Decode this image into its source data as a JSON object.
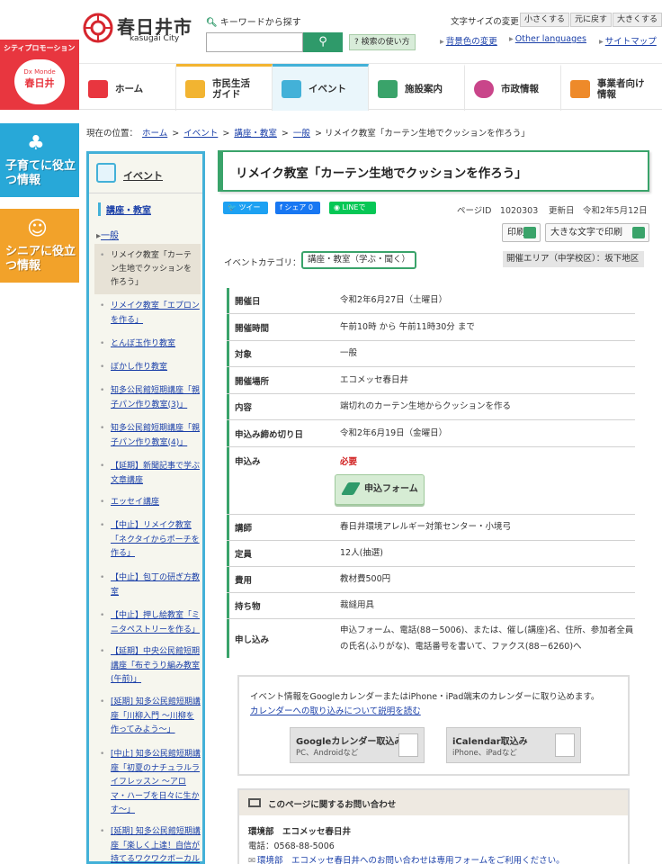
{
  "header": {
    "logo_jp": "春日井市",
    "logo_en": "kasugai City",
    "search_label": "キーワードから探す",
    "search_placeholder": "",
    "search_help": "検索の使い方",
    "font_size_label": "文字サイズの変更",
    "font_small": "小さくする",
    "font_reset": "元に戻す",
    "font_large": "大きくする",
    "bg_color": "背景色の変更",
    "other_lang": "Other languages",
    "sitemap": "サイトマップ"
  },
  "promos": {
    "city_promo_top": "シティプロモーション",
    "city_promo_brand": "Dx Monde",
    "city_promo_name": "春日井",
    "childcare": "子育てに役立つ情報",
    "senior": "シニアに役立つ情報"
  },
  "nav": {
    "items": [
      {
        "label": "ホーム"
      },
      {
        "label": "市民生活ガイド"
      },
      {
        "label": "イベント"
      },
      {
        "label": "施設案内"
      },
      {
        "label": "市政情報"
      },
      {
        "label": "事業者向け情報"
      }
    ]
  },
  "breadcrumb": {
    "prefix": "現在の位置：",
    "links": [
      "ホーム",
      "イベント",
      "講座・教室",
      "一般"
    ],
    "sep": ">",
    "current": "リメイク教室「カーテン生地でクッションを作ろう」"
  },
  "sidebar": {
    "heading": "イベント",
    "category": "講座・教室",
    "subcategory": "一般",
    "current": "リメイク教室「カーテン生地でクッションを作ろう」",
    "items": [
      "リメイク教室「エプロンを作る」",
      "とんぼ玉作り教室",
      "ぼかし作り教室",
      "知多公民館短期講座「親子パン作り教室(3)」",
      "知多公民館短期講座「親子パン作り教室(4)」",
      "【延期】新聞記事で学ぶ文章講座",
      "エッセイ講座",
      "【中止】リメイク教室「ネクタイからポーチを作る」",
      "【中止】包丁の研ぎ方教室",
      "【中止】押し絵教室「ミニタペストリーを作る」",
      "【延期】中央公民館短期講座「布ぞうり編み教室(午前)」",
      "[延期] 知多公民館短期講座「川柳入門 ～川柳を作ってみよう～」",
      "[中止] 知多公民館短期講座「初夏のナチュラルライフレッスン ～アロマ・ハーブを日々に生かす～」",
      "[延期] 知多公民館短期講座「楽しく上達！自信が持てるワクワクボーカル"
    ]
  },
  "page": {
    "title": "リメイク教室「カーテン生地でクッションを作ろう」",
    "tweet": "ツイート",
    "share": "シェア 0",
    "line": "LINEで送る",
    "page_id": "ページID　1020303",
    "updated": "更新日　令和2年5月12日",
    "print": "印刷",
    "print_large": "大きな文字で印刷",
    "category_label": "イベントカテゴリ：",
    "category_value": "講座・教室（学ぶ・聞く）",
    "area": "開催エリア（中学校区）：坂下地区"
  },
  "details": [
    {
      "key": "開催日",
      "value": "令和2年6月27日（土曜日）"
    },
    {
      "key": "開催時間",
      "value": "午前10時 から 午前11時30分 まで"
    },
    {
      "key": "対象",
      "value": "一般"
    },
    {
      "key": "開催場所",
      "value": "エコメッセ春日井"
    },
    {
      "key": "内容",
      "value": "端切れのカーテン生地からクッションを作る"
    },
    {
      "key": "申込み締め切り日",
      "value": "令和2年6月19日（金曜日）"
    },
    {
      "key": "申込み",
      "value": "必要",
      "button": "申込フォーム"
    },
    {
      "key": "講師",
      "value": "春日井環境アレルギー対策センター・小境弓"
    },
    {
      "key": "定員",
      "value": "12人(抽選)"
    },
    {
      "key": "費用",
      "value": "教材費500円"
    },
    {
      "key": "持ち物",
      "value": "裁縫用具"
    },
    {
      "key": "申し込み",
      "value": "申込フォーム、電話(88－5006)、または、催し(講座)名、住所、参加者全員の氏名(ふりがな)、電話番号を書いて、ファクス(88－6260)へ"
    }
  ],
  "calendar": {
    "message": "イベント情報をGoogleカレンダーまたはiPhone・iPad端末のカレンダーに取り込めます。",
    "link": "カレンダーへの取り込みについて説明を読む",
    "google": "Googleカレンダー取込み",
    "google_sub": "PC、Androidなど",
    "ical": "iCalendar取込み",
    "ical_sub": "iPhone、iPadなど"
  },
  "contact": {
    "heading": "このページに関するお問い合わせ",
    "dept": "環境部　エコメッセ春日井",
    "tel": "電話：0568-88-5006",
    "form": "環境部　エコメッセ春日井へのお問い合わせは専用フォームをご利用ください。"
  },
  "colors": {
    "accent_green": "#3aa36a",
    "link_blue": "#1a3fa8",
    "event_blue": "#43b1d8",
    "required_red": "#d01f1f"
  }
}
